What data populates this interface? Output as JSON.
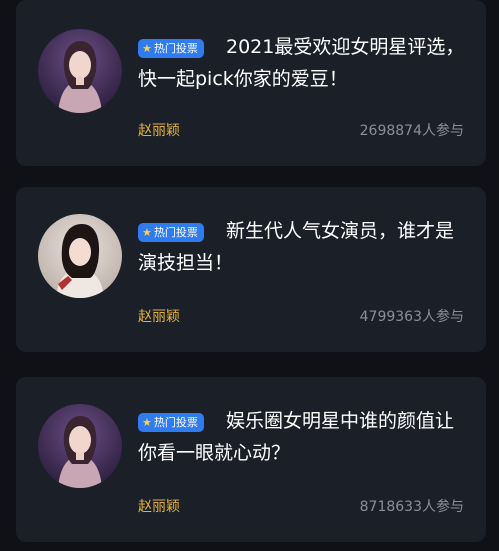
{
  "cards": [
    {
      "badge_label": "热门投票",
      "badge_icon": "star-icon",
      "title": "2021最受欢迎女明星评选，快一起pick你家的爱豆！",
      "star_name": "赵丽颖",
      "participants": "2698874人参与"
    },
    {
      "badge_label": "热门投票",
      "badge_icon": "star-icon",
      "title": "新生代人气女演员，谁才是演技担当！",
      "star_name": "赵丽颖",
      "participants": "4799363人参与"
    },
    {
      "badge_label": "热门投票",
      "badge_icon": "star-icon",
      "title": "娱乐圈女明星中谁的颜值让你看一眼就心动？",
      "star_name": "赵丽颖",
      "participants": "8718633人参与"
    }
  ],
  "colors": {
    "background": "#0f1116",
    "card": "#1b1f28",
    "badge": "#2f7bf0",
    "name": "#e3b23a",
    "count": "#8b8f99"
  }
}
